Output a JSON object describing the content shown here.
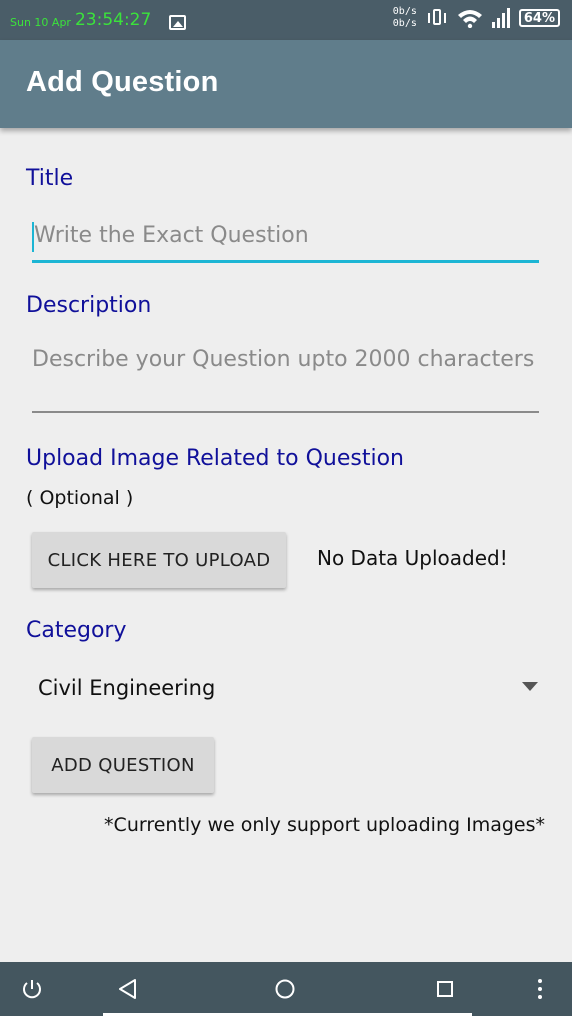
{
  "status_bar": {
    "date": "Sun 10 Apr",
    "time": "23:54:27",
    "net_up": "0b/s",
    "net_down": "0b/s",
    "battery": "64%",
    "icons": [
      "image-icon",
      "vibrate-icon",
      "wifi-icon",
      "signal-icon",
      "battery-icon"
    ]
  },
  "app_bar": {
    "title": "Add Question"
  },
  "form": {
    "title_label": "Title",
    "title_placeholder": "Write the Exact Question",
    "description_label": "Description",
    "description_placeholder": "Describe your Question upto 2000 characters",
    "upload_label": "Upload Image Related to Question",
    "upload_optional": "( Optional )",
    "upload_button": "CLICK HERE TO UPLOAD",
    "upload_status": "No Data Uploaded!",
    "category_label": "Category",
    "category_selected": "Civil Engineering",
    "add_button": "ADD QUESTION",
    "note": "*Currently we only support uploading Images*"
  },
  "nav_bar": {
    "icons": [
      "power-icon",
      "back-icon",
      "home-icon",
      "recents-icon",
      "more-icon"
    ]
  },
  "colors": {
    "status_bar": "#4a5d68",
    "app_bar": "#607d8b",
    "label": "#10109a",
    "accent": "#1cb5d4",
    "nav_bar": "#44565f"
  }
}
